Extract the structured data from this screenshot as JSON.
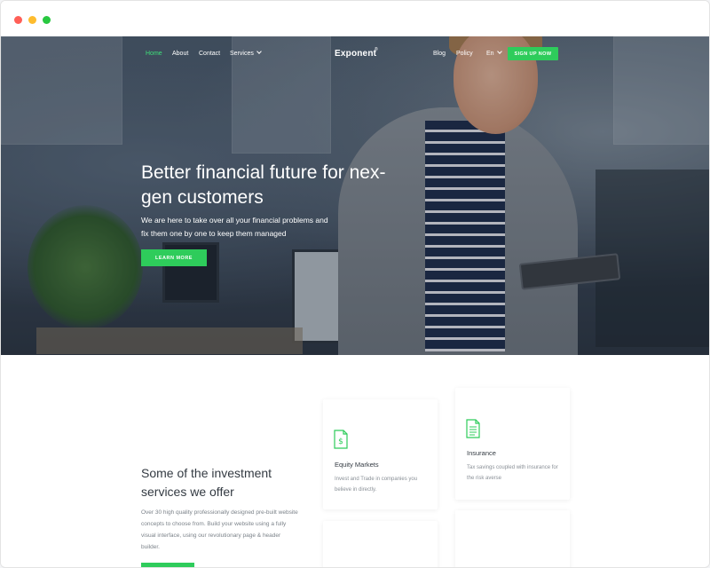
{
  "nav": {
    "home": "Home",
    "about": "About",
    "contact": "Contact",
    "services": "Services",
    "brand": "Exponent",
    "brand_mark": "®",
    "blog": "Blog",
    "policy": "Policy",
    "lang": "En",
    "signup": "SIGN UP NOW"
  },
  "hero": {
    "title": "Better financial future for nex-gen customers",
    "subtitle": "We are here to take over all your financial problems and fix them one by one to keep them managed",
    "cta": "LEARN MORE"
  },
  "services": {
    "title": "Some of the investment services we offer",
    "description": "Over 30 high quality professionally designed pre-built website concepts to choose from. Build your website using a fully visual interface, using our revolutionary page & header builder.",
    "cards": [
      {
        "icon": "dollar-document-icon",
        "title": "Equity Markets",
        "text": "Invest and Trade in companies you believe in directly."
      },
      {
        "icon": "document-list-icon",
        "title": "Insurance",
        "text": "Tax savings coupled with insurance for the risk averse"
      }
    ]
  },
  "colors": {
    "accent": "#2ecc5b",
    "active_nav": "#3ee07a",
    "heading": "#333a42",
    "muted": "#8a9097"
  }
}
